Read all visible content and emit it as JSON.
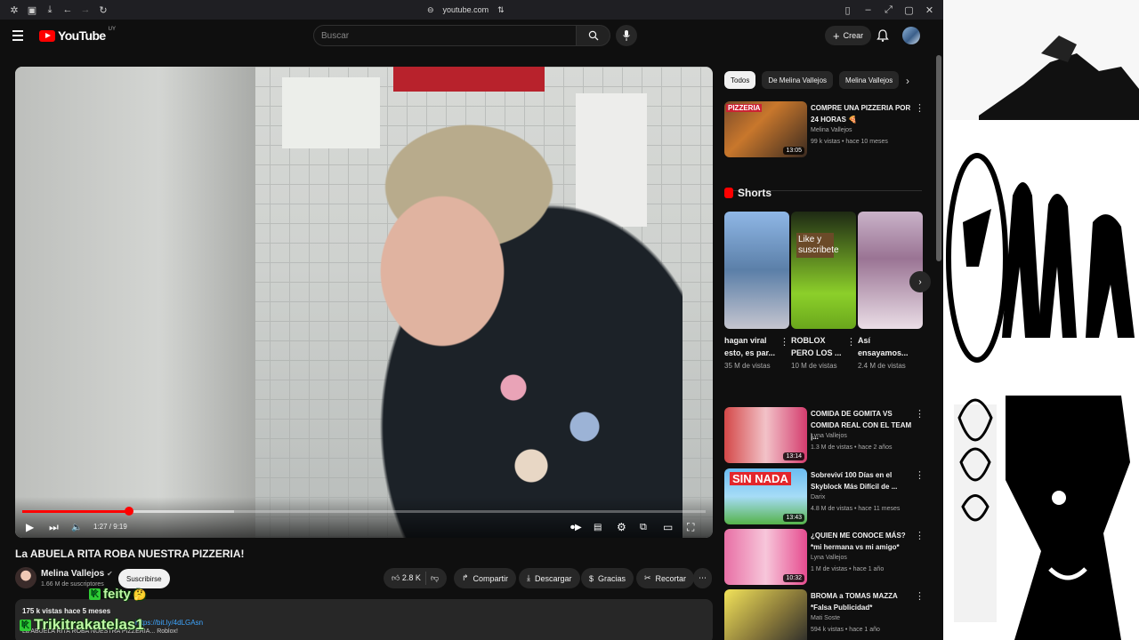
{
  "browser": {
    "url": "youtube.com"
  },
  "header": {
    "logo_text": "YouTube",
    "country_code": "UY",
    "search_placeholder": "Buscar",
    "create_label": "Crear"
  },
  "player": {
    "current_time": "1:27",
    "duration": "9:19",
    "progress_fraction": 0.156,
    "buffered_fraction": 0.31
  },
  "video": {
    "title": "La ABUELA RITA ROBA NUESTRA PIZZERIA!",
    "channel": "Melina Vallejos",
    "subscribers": "1.66 M de suscriptores",
    "subscribe_label": "Suscribirse",
    "likes": "2.8 K",
    "share_label": "Compartir",
    "download_label": "Descargar",
    "thanks_label": "Gracias",
    "clip_label": "Recortar",
    "stats": "175 k vistas  hace 5 meses",
    "desc_snippet": "La ABUELA RITA ROBA NUESTRA PIZZERIA... Roblox!",
    "link": "https://bit.ly/4dLGAsn"
  },
  "overlays": {
    "name1": "feity",
    "name2": "Trikitrakatelas1"
  },
  "sidebar": {
    "chips": [
      "Todos",
      "De Melina Vallejos",
      "Melina Vallejos"
    ],
    "shorts_title": "Shorts",
    "recs_top": [
      {
        "title": "COMPRE UNA PIZZERIA POR 24 HORAS 🍕",
        "channel": "Melina Vallejos",
        "meta": "99 k vistas • hace 10 meses",
        "duration": "13:05"
      }
    ],
    "shorts": [
      {
        "title": "hagan viral esto, es par...",
        "views": "35 M de vistas"
      },
      {
        "title": "ROBLOX PERO LOS ...",
        "views": "10 M de vistas",
        "thumb_text": "Like y suscribete"
      },
      {
        "title": "Así ensayamos...",
        "views": "2.4 M de vistas"
      }
    ],
    "recs": [
      {
        "title": "COMIDA DE GOMITA VS COMIDA REAL CON EL TEAM |...",
        "channel": "Lyna Vallejos",
        "meta": "1.3 M de vistas • hace 2 años",
        "duration": "13:14"
      },
      {
        "title": "Sobreviví 100 Días en el Skyblock Más Difícil de ...",
        "channel": "Darix",
        "meta": "4.8 M de vistas • hace 11 meses",
        "duration": "13:43",
        "thumb_text": "SIN NADA"
      },
      {
        "title": "¿QUIEN ME CONOCE MÁS? *mi hermana vs mi amigo*",
        "channel": "Lyna Vallejos",
        "meta": "1 M de vistas • hace 1 año",
        "duration": "10:32"
      },
      {
        "title": "BROMA a TOMAS MAZZA *Falsa Publicidad*",
        "channel": "Mati Soste",
        "meta": "594 k vistas • hace 1 año",
        "duration": ""
      }
    ]
  }
}
